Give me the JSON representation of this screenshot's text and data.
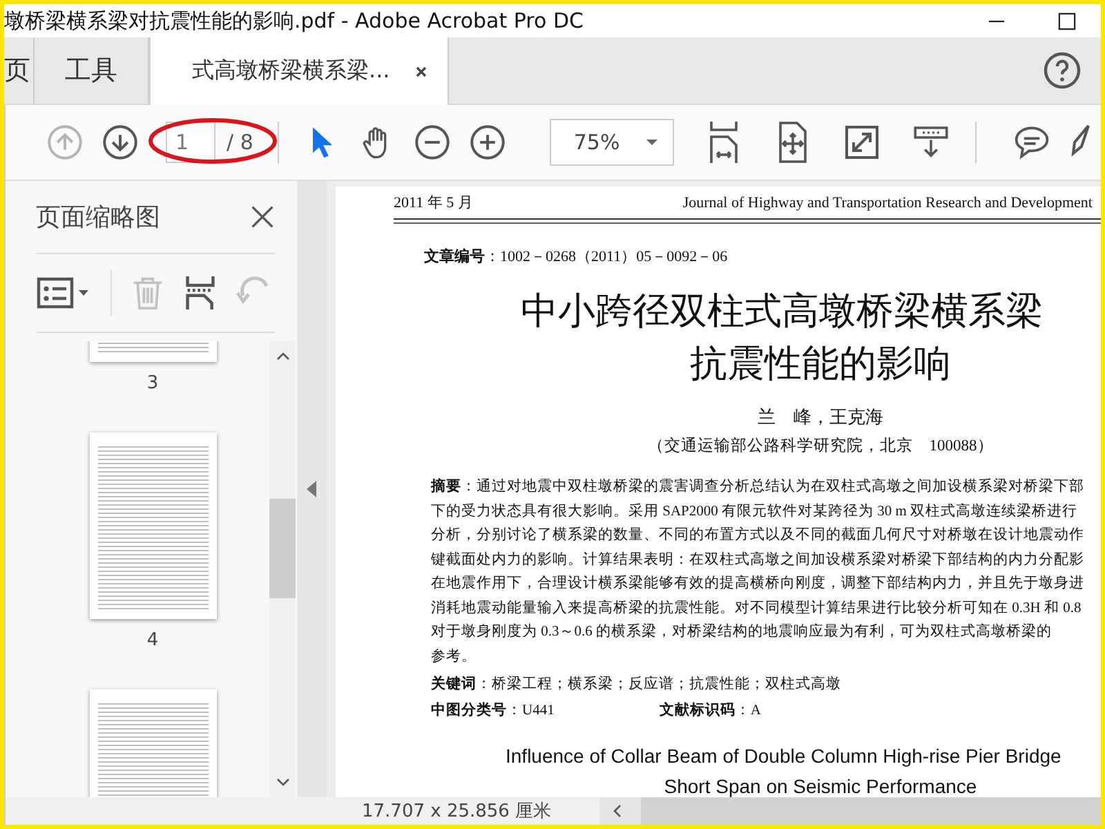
{
  "window": {
    "title": "墩桥梁横系梁对抗震性能的影响.pdf - Adobe Acrobat Pro DC"
  },
  "tabs": [
    {
      "label": "页",
      "selected": false
    },
    {
      "label": "工具",
      "selected": false
    },
    {
      "label": "式高墩桥梁横系梁...",
      "selected": true
    }
  ],
  "toolbar": {
    "nav": [
      {
        "kind": "prev",
        "disabled": true
      },
      {
        "kind": "next",
        "disabled": false
      }
    ],
    "page_field": {
      "value": "1"
    },
    "page_total": "/ 8",
    "tools": [
      {
        "kind": "select",
        "selected": true
      },
      {
        "kind": "hand",
        "selected": false
      }
    ],
    "zoom_buttons": [
      {
        "kind": "out"
      },
      {
        "kind": "in"
      }
    ],
    "zoom": {
      "value": "75%"
    },
    "view_buttons": [
      {
        "kind": "scroll-mode"
      },
      {
        "kind": "fit-page"
      },
      {
        "kind": "full-screen"
      },
      {
        "kind": "read-mode"
      }
    ],
    "annotate_buttons": [
      {
        "kind": "comment"
      },
      {
        "kind": "highlight"
      }
    ]
  },
  "thumbnail_pane": {
    "title": "页面缩略图",
    "tools": [
      {
        "kind": "options",
        "disabled": false
      },
      {
        "kind": "delete",
        "disabled": true
      },
      {
        "kind": "extract",
        "disabled": false
      },
      {
        "kind": "rotate",
        "disabled": true
      }
    ],
    "thumbnails": [
      {
        "label": "3"
      },
      {
        "label": "4"
      }
    ],
    "more_below": true
  },
  "document": {
    "header_left": "2011 年 5 月",
    "header_right": "Journal of Highway and Transportation Research and Development",
    "article_no": "**文章编号**：1002－0268（2011）05－0092－06",
    "title_lines": [
      "中小跨径双柱式高墩桥梁横系梁",
      "抗震性能的影响"
    ],
    "authors": "兰　峰，王克海",
    "affiliation": "（交通运输部公路科学研究院，北京　100088）",
    "abstract_lines": [
      "**摘要**：通过对地震中双柱墩桥梁的震害调查分析总结认为在双柱式高墩之间加设横系梁对桥梁下部",
      "下的受力状态具有很大影响。采用 SAP2000 有限元软件对某跨径为 30 m 双柱式高墩连续梁桥进行",
      "分析，分别讨论了横系梁的数量、不同的布置方式以及不同的截面几何尺寸对桥墩在设计地震动作",
      "键截面处内力的影响。计算结果表明：在双柱式高墩之间加设横系梁对桥梁下部结构的内力分配影",
      "在地震作用下，合理设计横系梁能够有效的提高横桥向刚度，调整下部结构内力，并且先于墩身进",
      "消耗地震动能量输入来提高桥梁的抗震性能。对不同模型计算结果进行比较分析可知在 0.3H 和 0.8",
      "对于墩身刚度为 0.3～0.6 的横系梁，对桥梁结构的地震响应最为有利，可为双柱式高墩桥梁的",
      "参考。"
    ],
    "keywords": "**关键词**：桥梁工程；横系梁；反应谱；抗震性能；双柱式高墩",
    "classification": "**中图分类号**：U441",
    "doc_code": "**文献标识码**：A",
    "english_title_lines": [
      "Influence of Collar Beam of Double Column High-rise Pier Bridge",
      "Short Span on Seismic Performance"
    ]
  },
  "status_bar": {
    "page_size": "17.707 x 25.856 厘米"
  }
}
